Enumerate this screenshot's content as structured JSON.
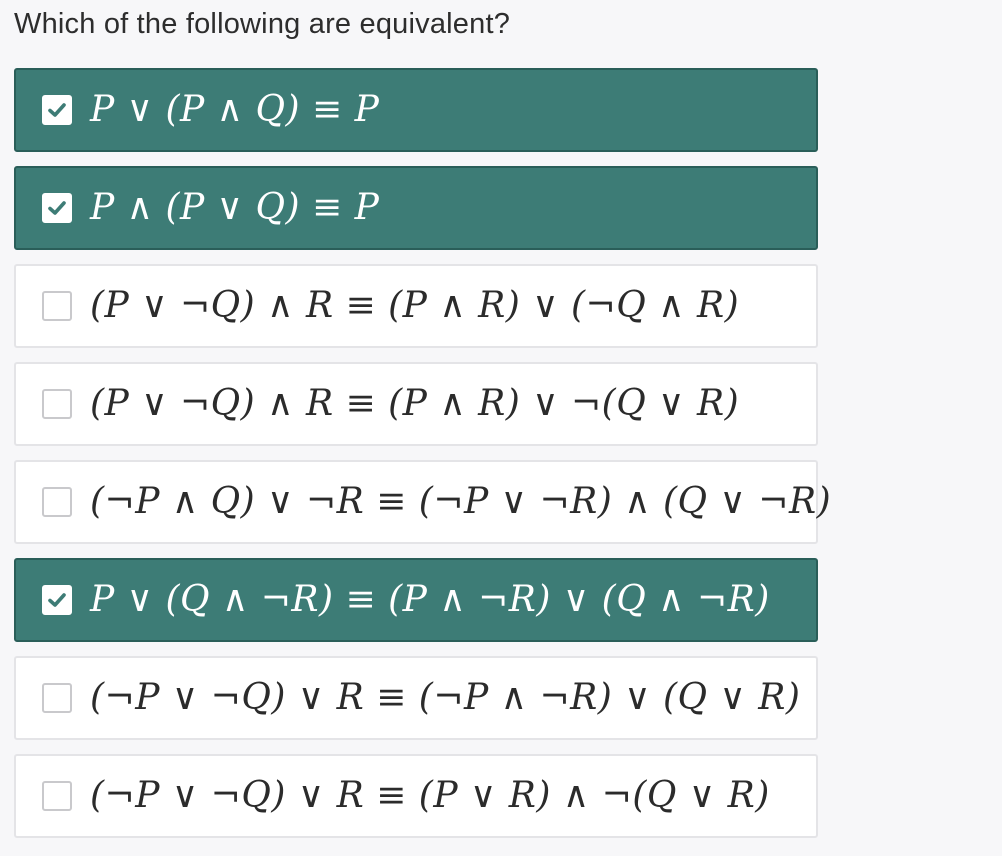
{
  "question": {
    "title": "Which of the following are equivalent?"
  },
  "colors": {
    "selected_bg": "#3d7c76",
    "unselected_bg": "#ffffff",
    "border": "#e4e4e7",
    "text": "#2d2d2d"
  },
  "options": [
    {
      "formula": "P ∨ (P ∧ Q) ≡ P",
      "checked": true
    },
    {
      "formula": "P ∧ (P ∨ Q) ≡ P",
      "checked": true
    },
    {
      "formula": "(P ∨ ¬Q) ∧ R ≡ (P ∧ R) ∨ (¬Q ∧ R)",
      "checked": false
    },
    {
      "formula": "(P ∨ ¬Q) ∧ R ≡ (P ∧ R) ∨ ¬(Q ∨ R)",
      "checked": false
    },
    {
      "formula": "(¬P ∧ Q) ∨ ¬R ≡ (¬P ∨ ¬R) ∧ (Q ∨ ¬R)",
      "checked": false
    },
    {
      "formula": "P ∨ (Q ∧ ¬R) ≡ (P ∧ ¬R) ∨ (Q ∧ ¬R)",
      "checked": true
    },
    {
      "formula": "(¬P ∨ ¬Q) ∨ R ≡ (¬P ∧ ¬R) ∨ (Q ∨ R)",
      "checked": false
    },
    {
      "formula": "(¬P ∨ ¬Q) ∨ R ≡ (P ∨ R) ∧ ¬(Q ∨ R)",
      "checked": false
    }
  ]
}
